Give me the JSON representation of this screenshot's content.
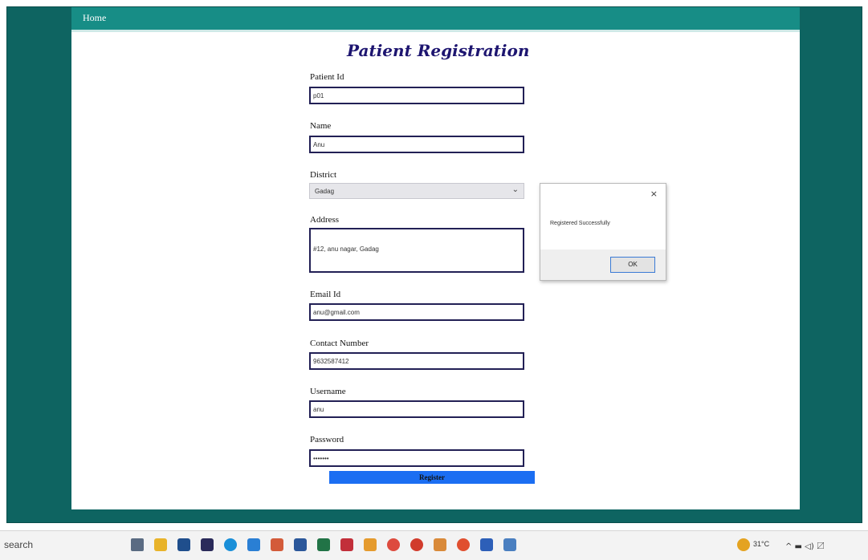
{
  "nav": {
    "home": "Home"
  },
  "form": {
    "title": "Patient Registration",
    "patient_id": {
      "label": "Patient Id",
      "value": "p01"
    },
    "name": {
      "label": "Name",
      "value": "Anu"
    },
    "district": {
      "label": "District",
      "value": "Gadag"
    },
    "address": {
      "label": "Address",
      "value": "#12, anu nagar, Gadag"
    },
    "email": {
      "label": "Email Id",
      "value": "anu@gmail.com"
    },
    "contact": {
      "label": "Contact Number",
      "value": "9632587412"
    },
    "username": {
      "label": "Username",
      "value": "anu"
    },
    "password": {
      "label": "Password",
      "value": "•••••••"
    },
    "register": "Register"
  },
  "dialog": {
    "message": "Registered Successfully",
    "ok": "OK",
    "close": "×"
  },
  "taskbar": {
    "search": "search",
    "weather": "31°C",
    "tray": "^ ▬ ◁) 〼"
  },
  "colors": {
    "outer": "#0e6461",
    "navbar": "#178d86",
    "button": "#1b6ef2",
    "title": "#1d1570"
  }
}
